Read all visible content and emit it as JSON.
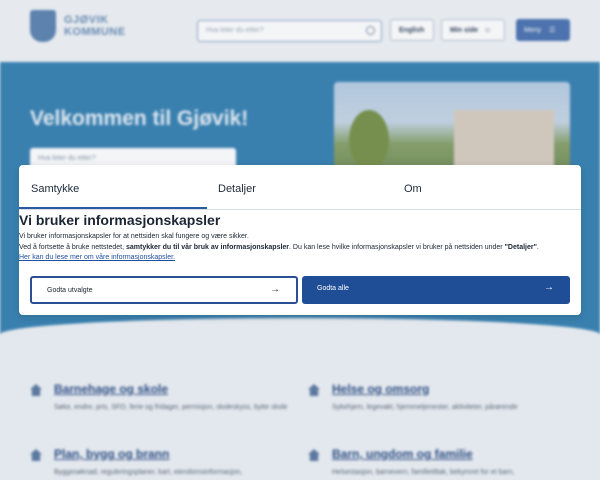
{
  "header": {
    "logo_line1": "GJØVIK",
    "logo_line2": "KOMMUNE",
    "search_placeholder": "Hva leter du etter?",
    "english_label": "English",
    "minside_label": "Min side",
    "menu_label": "Meny"
  },
  "hero": {
    "title": "Velkommen til Gjøvik!",
    "search_placeholder": "Hva leter du etter?"
  },
  "categories": [
    {
      "title": "Barnehage og skole",
      "desc": "Søke, endre, pris, SFO, ferie og fridager, permisjon, skoleskyss, bytte skole"
    },
    {
      "title": "Helse og omsorg",
      "desc": "Sykehjem, legevakt, hjemmetjenester, aktiviteter, pårørende"
    },
    {
      "title": "Plan, bygg og brann",
      "desc": "Byggesøknad, reguleringsplaner, kart, eiendomsinformasjon,"
    },
    {
      "title": "Barn, ungdom og familie",
      "desc": "Helsestasjon, barnevern, familietiltak, bekymret for et barn,"
    }
  ],
  "consent": {
    "tabs": [
      "Samtykke",
      "Detaljer",
      "Om"
    ],
    "title": "Vi bruker informasjonskapsler",
    "line1": "Vi bruker informasjonskapsler for at nettsiden skal fungere og være sikker.",
    "line2_a": "Ved å fortsette å bruke nettstedet, ",
    "line2_b": "samtykker du til vår bruk av informasjonskapsler",
    "line2_c": ".  Du kan lese hvilke informasjonskapsler vi bruker på nettsiden under ",
    "line2_d": "\"Detaljer\"",
    "line2_e": ".",
    "link": "Her kan du lese mer om våre informasjonskapsler.",
    "btn_selected": "Godta utvalgte",
    "btn_all": "Godta alle",
    "arrow": "→"
  },
  "colors": {
    "accent": "#1f4e96",
    "hero_bg": "#3b84b4"
  }
}
